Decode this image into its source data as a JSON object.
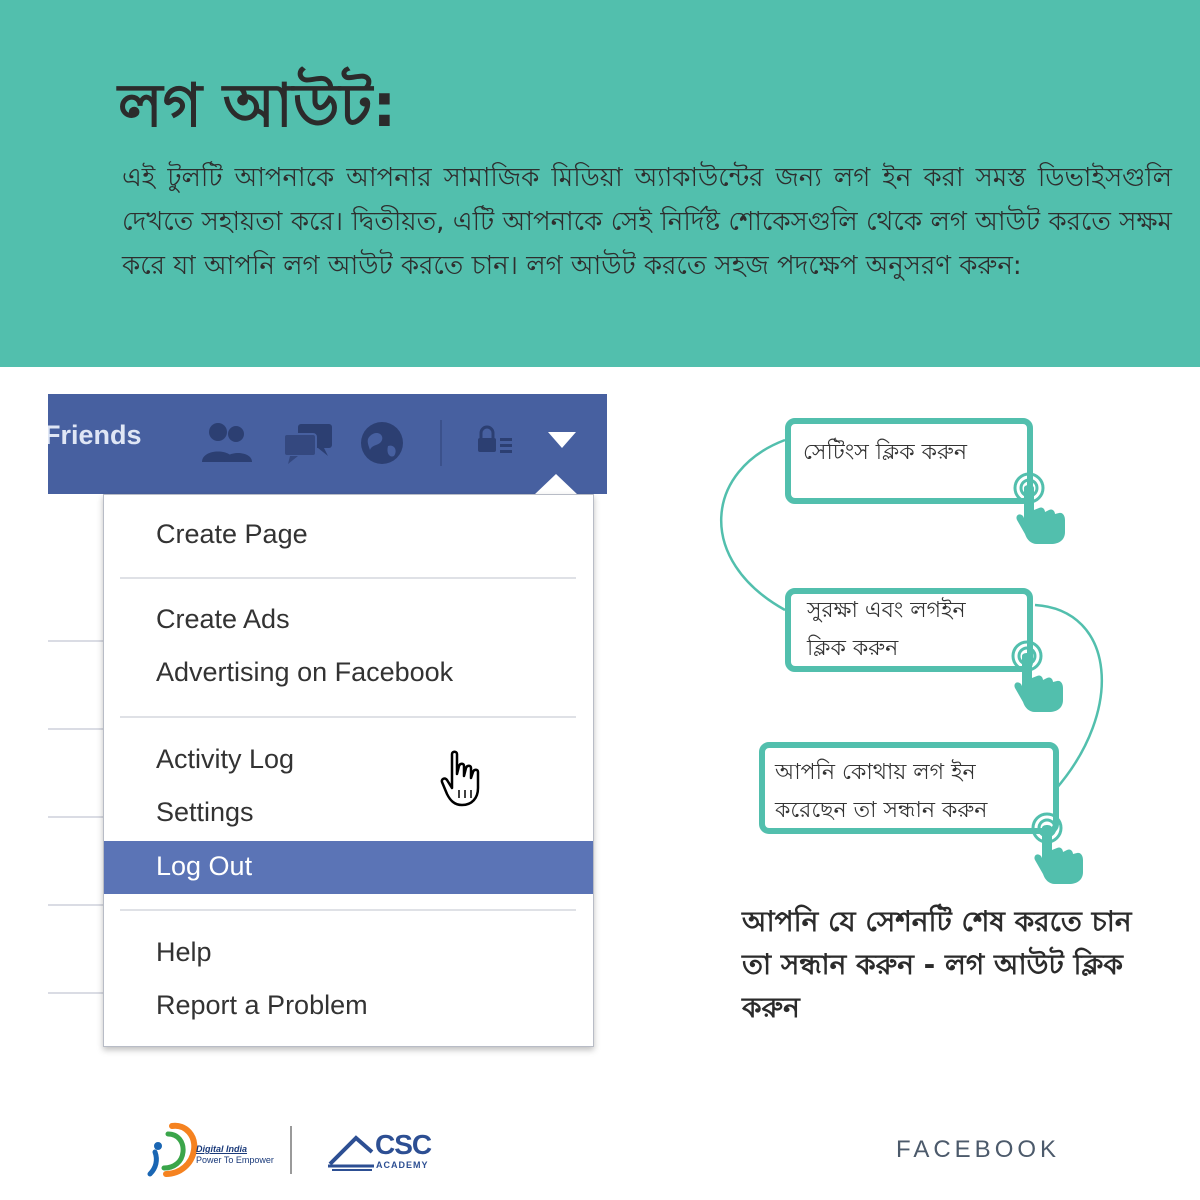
{
  "header": {
    "title": "লগ আউট:",
    "intro": "এই টুলটি আপনাকে আপনার সামাজিক মিডিয়া অ্যাকাউন্টের জন্য লগ ইন করা সমস্ত ডিভাইসগুলি দেখতে সহায়তা করে। দ্বিতীয়ত, এটি আপনাকে সেই নির্দিষ্ট শোকেসগুলি থেকে লগ আউট করতে সক্ষম করে যা আপনি লগ আউট করতে চান। লগ আউট করতে সহজ পদক্ষেপ অনুসরণ করুন:",
    "background_color": "#52bfad"
  },
  "facebook": {
    "nav_label": "Friends",
    "bar_color": "#4760a0",
    "menu": {
      "group1": [
        "Create Page"
      ],
      "group2": [
        "Create Ads",
        "Advertising on Facebook"
      ],
      "group3": [
        "Activity Log",
        "Settings",
        "Log Out"
      ],
      "group4": [
        "Help",
        "Report a Problem"
      ],
      "highlighted": "Log Out",
      "highlight_color": "#5b74b6"
    }
  },
  "steps": [
    {
      "text_lines": [
        "সেটিংস ক্লিক করুন"
      ]
    },
    {
      "text_lines": [
        "সুরক্ষা এবং লগইন",
        "ক্লিক করুন"
      ]
    },
    {
      "text_lines": [
        "আপনি কোথায় লগ ইন",
        "করেছেন তা সন্ধান করুন"
      ]
    }
  ],
  "final_instruction": "আপনি যে সেশনটি শেষ করতে চান তা সন্ধান করুন - লগ আউট ক্লিক করুন",
  "footer": {
    "digital_india_title": "Digital India",
    "digital_india_tagline": "Power To Empower",
    "csc_name": "CSC",
    "csc_sub": "ACADEMY",
    "brand": "FACEBOOK"
  },
  "accent_color": "#52bfad"
}
